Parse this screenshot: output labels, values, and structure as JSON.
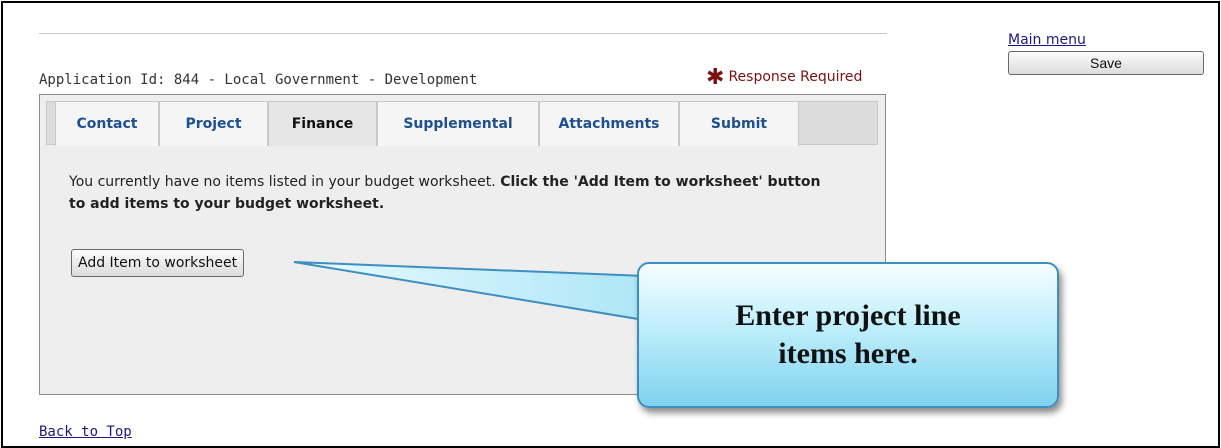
{
  "header": {
    "main_menu": "Main menu",
    "save": "Save",
    "application_id": "Application Id: 844 - Local Government - Development",
    "response_required": "Response Required",
    "required_marker": "✱"
  },
  "tabs": [
    {
      "label": "Contact",
      "active": false
    },
    {
      "label": "Project",
      "active": false
    },
    {
      "label": "Finance",
      "active": true
    },
    {
      "label": "Supplemental",
      "active": false
    },
    {
      "label": "Attachments",
      "active": false
    },
    {
      "label": "Submit",
      "active": false
    }
  ],
  "finance": {
    "message_plain": "You currently have no items listed in your budget worksheet. ",
    "message_bold": "Click the 'Add Item to worksheet' button to add items to your budget worksheet.",
    "add_item_button": "Add Item to worksheet"
  },
  "callout": {
    "text": "Enter project line items here."
  },
  "footer": {
    "back_to_top": "Back to Top"
  },
  "colors": {
    "link": "#1a1a80",
    "tab_text": "#1e4f8f",
    "required": "#7a1212",
    "callout_border": "#3f8ec2"
  }
}
